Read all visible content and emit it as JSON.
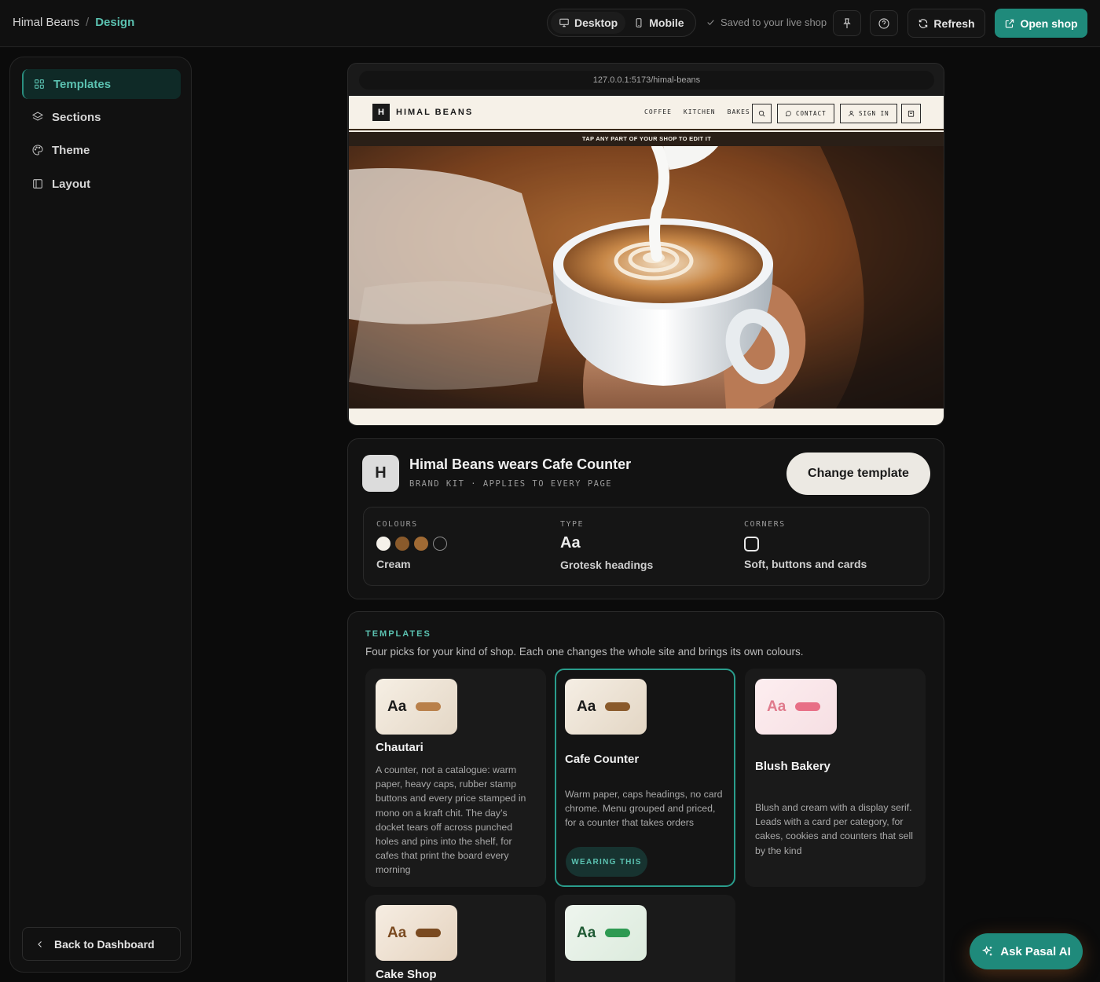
{
  "breadcrumb": {
    "shop": "Himal Beans",
    "separator": "/",
    "current": "Design"
  },
  "toolbar": {
    "desktop_label": "Desktop",
    "mobile_label": "Mobile",
    "saved_status": "Saved to your live shop",
    "refresh_label": "Refresh",
    "open_shop_label": "Open shop"
  },
  "sidebar": {
    "items": [
      {
        "label": "Templates",
        "icon": "grid-icon",
        "active": true
      },
      {
        "label": "Sections",
        "icon": "layers-icon",
        "active": false
      },
      {
        "label": "Theme",
        "icon": "palette-icon",
        "active": false
      },
      {
        "label": "Layout",
        "icon": "panel-icon",
        "active": false
      }
    ],
    "back_label": "Back to Dashboard"
  },
  "preview": {
    "url": "127.0.0.1:5173/himal-beans",
    "site": {
      "logo_letter": "H",
      "name": "HIMAL BEANS",
      "links": [
        "COFFEE",
        "KITCHEN",
        "BAKES"
      ],
      "contact_label": "CONTACT",
      "signin_label": "SIGN IN",
      "edit_hint": "TAP ANY PART OF YOUR SHOP TO EDIT IT"
    }
  },
  "brand": {
    "avatar_letter": "H",
    "title": "Himal Beans wears Cafe Counter",
    "subtitle": "BRAND KIT · APPLIES TO EVERY PAGE",
    "change_label": "Change template",
    "colours_label": "COLOURS",
    "colours_value": "Cream",
    "swatches": [
      "#f5f1ea",
      "#8a5a2b",
      "#a06a34",
      "#151515"
    ],
    "type_label": "TYPE",
    "type_sample": "Aa",
    "type_value": "Grotesk headings",
    "corners_label": "CORNERS",
    "corners_value": "Soft, buttons and cards"
  },
  "templates": {
    "heading": "TEMPLATES",
    "description": "Four picks for your kind of shop. Each one changes the whole site and brings its own colours.",
    "sample": "Aa",
    "wearing_label": "WEARING THIS",
    "items": [
      {
        "name": "Chautari",
        "description": "A counter, not a catalogue: warm paper, heavy caps, rubber stamp buttons and every price stamped in mono on a kraft chit. The day’s docket tears off across punched holes and pins into the shelf, for cafes that print the board every morning",
        "accent": "#b9804a",
        "aa_color": "#1a1a1a"
      },
      {
        "name": "Cafe Counter",
        "description": "Warm paper, caps headings, no card chrome. Menu grouped and priced, for a counter that takes orders",
        "accent": "#8a5a2b",
        "aa_color": "#1a1a1a"
      },
      {
        "name": "Blush Bakery",
        "description": "Blush and cream with a display serif. Leads with a card per category, for cakes, cookies and counters that sell by the kind",
        "accent": "#e86f86",
        "aa_color": "#e07a8c"
      },
      {
        "name": "Cake Shop",
        "accent": "#7a4a20",
        "aa_color": "#7a4a20"
      },
      {
        "name": "",
        "accent": "#2e9a52",
        "aa_color": "#1f5a34"
      }
    ]
  },
  "ask_ai_label": "Ask Pasal AI"
}
